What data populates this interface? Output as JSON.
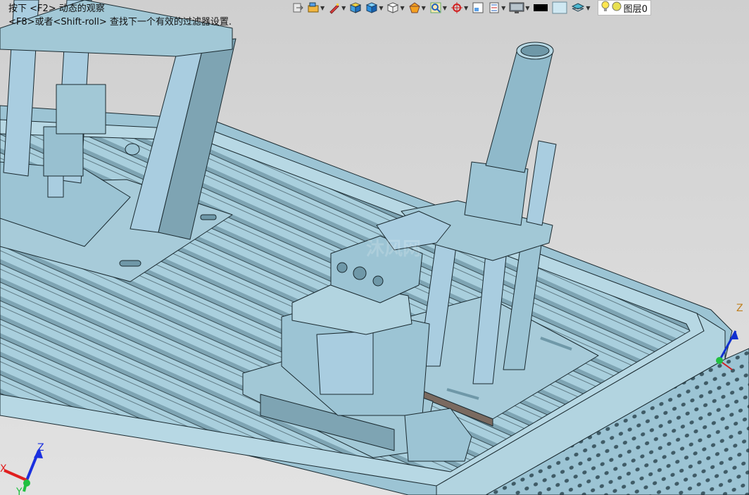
{
  "hints": {
    "line1": "按下 <F2> 动态的观察",
    "line2": "<F8>或者<Shift-roll> 查找下一个有效的过滤器设置."
  },
  "toolbar": {
    "icons": [
      "exit-icon",
      "selection-filter-icon",
      "sketch-pen-icon",
      "shaded-cube-icon",
      "blue-cube-icon",
      "wireframe-cube-icon",
      "section-view-icon",
      "zoom-fit-icon",
      "target-icon",
      "view-layout-icon",
      "ruler-icon",
      "monitor-icon",
      "black-color-swatch",
      "light-color-swatch",
      "layers-icon",
      "bulb-icon"
    ],
    "layer_label": "图层0"
  },
  "triad_corner": {
    "x": "X",
    "y": "Y",
    "z": "Z"
  },
  "triad_model": {
    "z": "Z"
  },
  "watermark": "沐风网",
  "colors": {
    "model": "#9cc4d4",
    "model_dark": "#6f98a8",
    "edge": "#1a2a30",
    "background": "#d8d8d8"
  }
}
